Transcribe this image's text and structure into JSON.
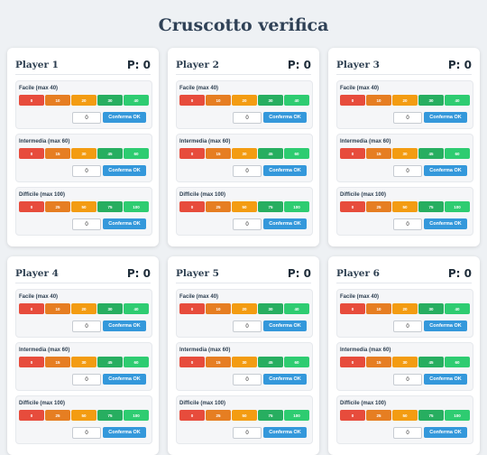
{
  "title": "Cruscotto verifica",
  "players": [
    {
      "name": "Player 1",
      "points": "P: 0"
    },
    {
      "name": "Player 2",
      "points": "P: 0"
    },
    {
      "name": "Player 3",
      "points": "P: 0"
    },
    {
      "name": "Player 4",
      "points": "P: 0"
    },
    {
      "name": "Player 5",
      "points": "P: 0"
    },
    {
      "name": "Player 6",
      "points": "P: 0"
    }
  ],
  "sections": [
    {
      "label": "Facile (max 40)",
      "values": [
        "0",
        "10",
        "20",
        "30",
        "40"
      ]
    },
    {
      "label": "Intermedia (max 60)",
      "values": [
        "0",
        "15",
        "30",
        "45",
        "60"
      ]
    },
    {
      "label": "Difficile (max 100)",
      "values": [
        "0",
        "25",
        "50",
        "75",
        "100"
      ]
    }
  ],
  "input_value": "0",
  "confirm_label": "Conferma OK"
}
